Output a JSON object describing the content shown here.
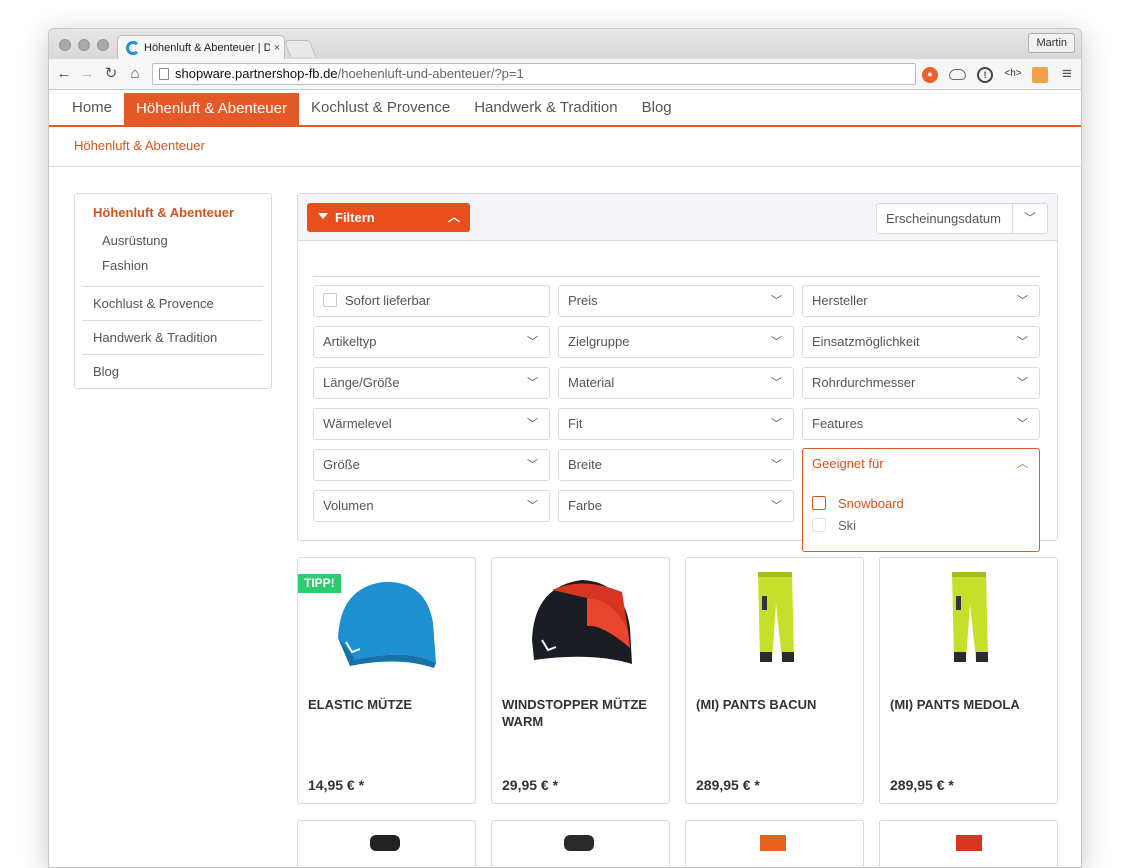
{
  "browser": {
    "tab_title": "Höhenluft & Abenteuer | Do",
    "tab_close": "×",
    "profile_name": "Martin",
    "url_host": "shopware.partnershop-fb.de",
    "url_path": "/hoehenluft-und-abenteuer/?p=1",
    "back": "←",
    "forward": "→",
    "reload": "↻",
    "home": "⌂",
    "star": "☆",
    "menu": "≡"
  },
  "nav": {
    "items": [
      "Home",
      "Höhenluft & Abenteuer",
      "Kochlust & Provence",
      "Handwerk & Tradition",
      "Blog"
    ],
    "active_index": 1
  },
  "breadcrumb": "Höhenluft & Abenteuer",
  "sidebar": {
    "main": "Höhenluft & Abenteuer",
    "subs": [
      "Ausrüstung",
      "Fashion"
    ],
    "items": [
      "Kochlust & Provence",
      "Handwerk & Tradition",
      "Blog"
    ]
  },
  "filter": {
    "button_label": "Filtern",
    "sort_value": "Erscheinungsdatum",
    "fields": [
      [
        "Sofort lieferbar",
        "Preis",
        "Hersteller"
      ],
      [
        "Artikeltyp",
        "Zielgruppe",
        "Einsatzmöglichkeit"
      ],
      [
        "Länge/Größe",
        "Material",
        "Rohrdurchmesser"
      ],
      [
        "Wärmelevel",
        "Fit",
        "Features"
      ],
      [
        "Größe",
        "Breite",
        "Geeignet für"
      ],
      [
        "Volumen",
        "Farbe"
      ]
    ],
    "open_dropdown": {
      "title": "Geeignet für",
      "options": [
        "Snowboard",
        "Ski"
      ]
    }
  },
  "products": [
    {
      "name": "ELASTIC MÜTZE",
      "price": "14,95 € *",
      "badge": "TIPP!",
      "icon": "blue-beanie-image"
    },
    {
      "name": "WINDSTOPPER MÜTZE WARM",
      "price": "29,95 € *",
      "badge": "",
      "icon": "black-red-beanie-image"
    },
    {
      "name": "(MI) PANTS BACUN",
      "price": "289,95 € *",
      "badge": "",
      "icon": "yellow-pants-image"
    },
    {
      "name": "(MI) PANTS MEDOLA",
      "price": "289,95 € *",
      "badge": "",
      "icon": "yellow-pants-image"
    }
  ],
  "colors": {
    "accent": "#e35a26",
    "filter_button": "#e84f1d",
    "tipp_badge": "#2dcc70"
  }
}
